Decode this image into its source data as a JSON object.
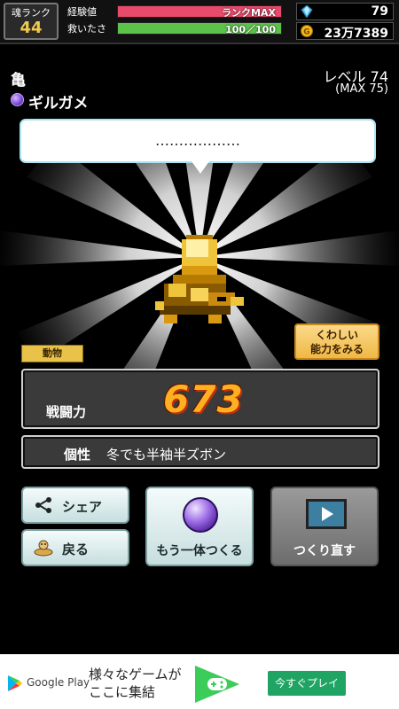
{
  "hud": {
    "rank_label": "魂ランク",
    "rank_value": "44",
    "exp_label": "経験値",
    "exp_text": "ランクMAX",
    "exp_fill": 1.0,
    "hp_label": "救いたさ",
    "hp_text": "100／100",
    "hp_fill": 1.0,
    "gems": "79",
    "gold": "23万7389"
  },
  "character": {
    "species": "亀",
    "name": "ギルガメ",
    "level": "レベル 74",
    "level_max": "(MAX 75)",
    "speech": "………………",
    "category_tag": "動物",
    "details_button": [
      "くわしい",
      "能力をみる"
    ]
  },
  "stats": {
    "power_label": "戦闘力",
    "power_value": "673",
    "trait_label": "個性",
    "trait_value": "冬でも半袖半ズボン"
  },
  "actions": {
    "share": "シェア",
    "back": "戻る",
    "make_another": "もう一体つくる",
    "redo": "つくり直す"
  },
  "ad": {
    "brand": "Google Play",
    "line1": "様々なゲームが",
    "line2": "ここに集結",
    "cta": "今すぐプレイ"
  },
  "colors": {
    "exp_bar": "#e84a6b",
    "hp_bar": "#5cc24a",
    "power_text": "#ffb020",
    "play_green": "#1fa463"
  },
  "icons": [
    "gem-icon",
    "gold-coin-icon",
    "purple-orb-icon",
    "share-icon",
    "back-icon",
    "video-icon",
    "google-play-icon",
    "gamepad-icon"
  ]
}
